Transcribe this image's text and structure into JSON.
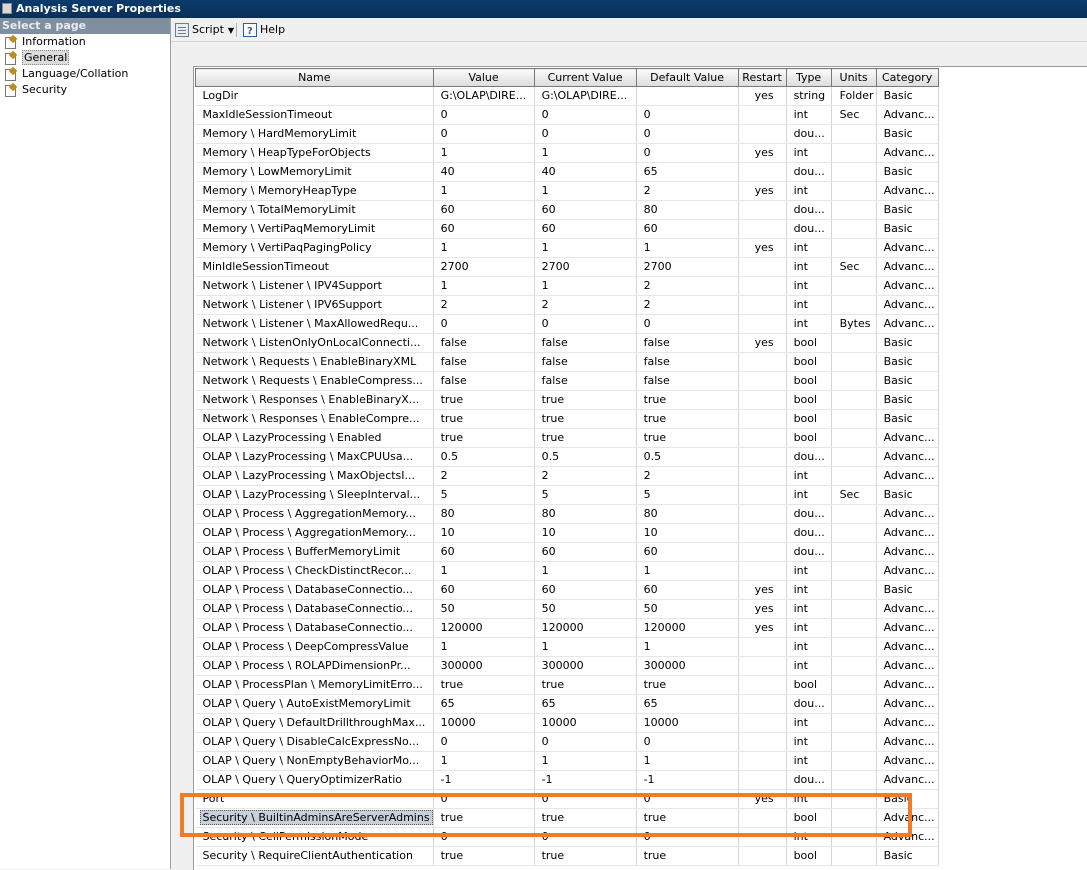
{
  "window": {
    "title": "Analysis Server Properties"
  },
  "sidebar": {
    "header": "Select a page",
    "items": [
      {
        "label": "Information",
        "icon": "page-icon"
      },
      {
        "label": "General",
        "icon": "page-icon",
        "selected": true
      },
      {
        "label": "Language/Collation",
        "icon": "page-icon"
      },
      {
        "label": "Security",
        "icon": "page-icon"
      }
    ]
  },
  "toolbar": {
    "script_label": "Script",
    "help_label": "Help"
  },
  "grid": {
    "columns": [
      "Name",
      "Value",
      "Current Value",
      "Default Value",
      "Restart",
      "Type",
      "Units",
      "Category"
    ],
    "rows": [
      [
        "LogDir",
        "G:\\OLAP\\DIRE...",
        "G:\\OLAP\\DIRE...",
        "",
        "yes",
        "string",
        "Folder",
        "Basic"
      ],
      [
        "MaxIdleSessionTimeout",
        "0",
        "0",
        "0",
        "",
        "int",
        "Sec",
        "Advanc..."
      ],
      [
        "Memory \\ HardMemoryLimit",
        "0",
        "0",
        "0",
        "",
        "dou...",
        "",
        "Basic"
      ],
      [
        "Memory \\ HeapTypeForObjects",
        "1",
        "1",
        "0",
        "yes",
        "int",
        "",
        "Advanc..."
      ],
      [
        "Memory \\ LowMemoryLimit",
        "40",
        "40",
        "65",
        "",
        "dou...",
        "",
        "Basic"
      ],
      [
        "Memory \\ MemoryHeapType",
        "1",
        "1",
        "2",
        "yes",
        "int",
        "",
        "Advanc..."
      ],
      [
        "Memory \\ TotalMemoryLimit",
        "60",
        "60",
        "80",
        "",
        "dou...",
        "",
        "Basic"
      ],
      [
        "Memory \\ VertiPaqMemoryLimit",
        "60",
        "60",
        "60",
        "",
        "dou...",
        "",
        "Basic"
      ],
      [
        "Memory \\ VertiPaqPagingPolicy",
        "1",
        "1",
        "1",
        "yes",
        "int",
        "",
        "Advanc..."
      ],
      [
        "MinIdleSessionTimeout",
        "2700",
        "2700",
        "2700",
        "",
        "int",
        "Sec",
        "Advanc..."
      ],
      [
        "Network \\ Listener \\ IPV4Support",
        "1",
        "1",
        "2",
        "",
        "int",
        "",
        "Advanc..."
      ],
      [
        "Network \\ Listener \\ IPV6Support",
        "2",
        "2",
        "2",
        "",
        "int",
        "",
        "Advanc..."
      ],
      [
        "Network \\ Listener \\ MaxAllowedRequ...",
        "0",
        "0",
        "0",
        "",
        "int",
        "Bytes",
        "Advanc..."
      ],
      [
        "Network \\ ListenOnlyOnLocalConnecti...",
        "false",
        "false",
        "false",
        "yes",
        "bool",
        "",
        "Basic"
      ],
      [
        "Network \\ Requests \\ EnableBinaryXML",
        "false",
        "false",
        "false",
        "",
        "bool",
        "",
        "Basic"
      ],
      [
        "Network \\ Requests \\ EnableCompress...",
        "false",
        "false",
        "false",
        "",
        "bool",
        "",
        "Basic"
      ],
      [
        "Network \\ Responses \\ EnableBinaryX...",
        "true",
        "true",
        "true",
        "",
        "bool",
        "",
        "Basic"
      ],
      [
        "Network \\ Responses \\ EnableCompre...",
        "true",
        "true",
        "true",
        "",
        "bool",
        "",
        "Basic"
      ],
      [
        "OLAP \\ LazyProcessing \\ Enabled",
        "true",
        "true",
        "true",
        "",
        "bool",
        "",
        "Advanc..."
      ],
      [
        "OLAP \\ LazyProcessing \\ MaxCPUUsa...",
        "0.5",
        "0.5",
        "0.5",
        "",
        "dou...",
        "",
        "Advanc..."
      ],
      [
        "OLAP \\ LazyProcessing \\ MaxObjectsI...",
        "2",
        "2",
        "2",
        "",
        "int",
        "",
        "Advanc..."
      ],
      [
        "OLAP \\ LazyProcessing \\ SleepInterval...",
        "5",
        "5",
        "5",
        "",
        "int",
        "Sec",
        "Basic"
      ],
      [
        "OLAP \\ Process \\ AggregationMemory...",
        "80",
        "80",
        "80",
        "",
        "dou...",
        "",
        "Advanc..."
      ],
      [
        "OLAP \\ Process \\ AggregationMemory...",
        "10",
        "10",
        "10",
        "",
        "dou...",
        "",
        "Advanc..."
      ],
      [
        "OLAP \\ Process \\ BufferMemoryLimit",
        "60",
        "60",
        "60",
        "",
        "dou...",
        "",
        "Advanc..."
      ],
      [
        "OLAP \\ Process \\ CheckDistinctRecor...",
        "1",
        "1",
        "1",
        "",
        "int",
        "",
        "Advanc..."
      ],
      [
        "OLAP \\ Process \\ DatabaseConnectio...",
        "60",
        "60",
        "60",
        "yes",
        "int",
        "",
        "Basic"
      ],
      [
        "OLAP \\ Process \\ DatabaseConnectio...",
        "50",
        "50",
        "50",
        "yes",
        "int",
        "",
        "Advanc..."
      ],
      [
        "OLAP \\ Process \\ DatabaseConnectio...",
        "120000",
        "120000",
        "120000",
        "yes",
        "int",
        "",
        "Advanc..."
      ],
      [
        "OLAP \\ Process \\ DeepCompressValue",
        "1",
        "1",
        "1",
        "",
        "int",
        "",
        "Advanc..."
      ],
      [
        "OLAP \\ Process \\ ROLAPDimensionPr...",
        "300000",
        "300000",
        "300000",
        "",
        "int",
        "",
        "Advanc..."
      ],
      [
        "OLAP \\ ProcessPlan \\ MemoryLimitErro...",
        "true",
        "true",
        "true",
        "",
        "bool",
        "",
        "Advanc..."
      ],
      [
        "OLAP \\ Query \\ AutoExistMemoryLimit",
        "65",
        "65",
        "65",
        "",
        "dou...",
        "",
        "Advanc..."
      ],
      [
        "OLAP \\ Query \\ DefaultDrillthroughMax...",
        "10000",
        "10000",
        "10000",
        "",
        "int",
        "",
        "Advanc..."
      ],
      [
        "OLAP \\ Query \\ DisableCalcExpressNo...",
        "0",
        "0",
        "0",
        "",
        "int",
        "",
        "Advanc..."
      ],
      [
        "OLAP \\ Query \\ NonEmptyBehaviorMo...",
        "1",
        "1",
        "1",
        "",
        "int",
        "",
        "Advanc..."
      ],
      [
        "OLAP \\ Query \\ QueryOptimizerRatio",
        "-1",
        "-1",
        "-1",
        "",
        "dou...",
        "",
        "Advanc..."
      ],
      [
        "Port",
        "0",
        "0",
        "0",
        "yes",
        "int",
        "",
        "Basic"
      ],
      [
        "Security \\ BuiltinAdminsAreServerAdmins",
        "true",
        "true",
        "true",
        "",
        "bool",
        "",
        "Advanc..."
      ],
      [
        "Security \\ CellPermissionMode",
        "0",
        "0",
        "0",
        "",
        "int",
        "",
        "Advanc..."
      ],
      [
        "Security \\ RequireClientAuthentication",
        "true",
        "true",
        "true",
        "",
        "bool",
        "",
        "Basic"
      ]
    ],
    "highlight_row": 38
  },
  "colors": {
    "callout": "#f07d25",
    "titlebar": "#0b3b6c"
  }
}
